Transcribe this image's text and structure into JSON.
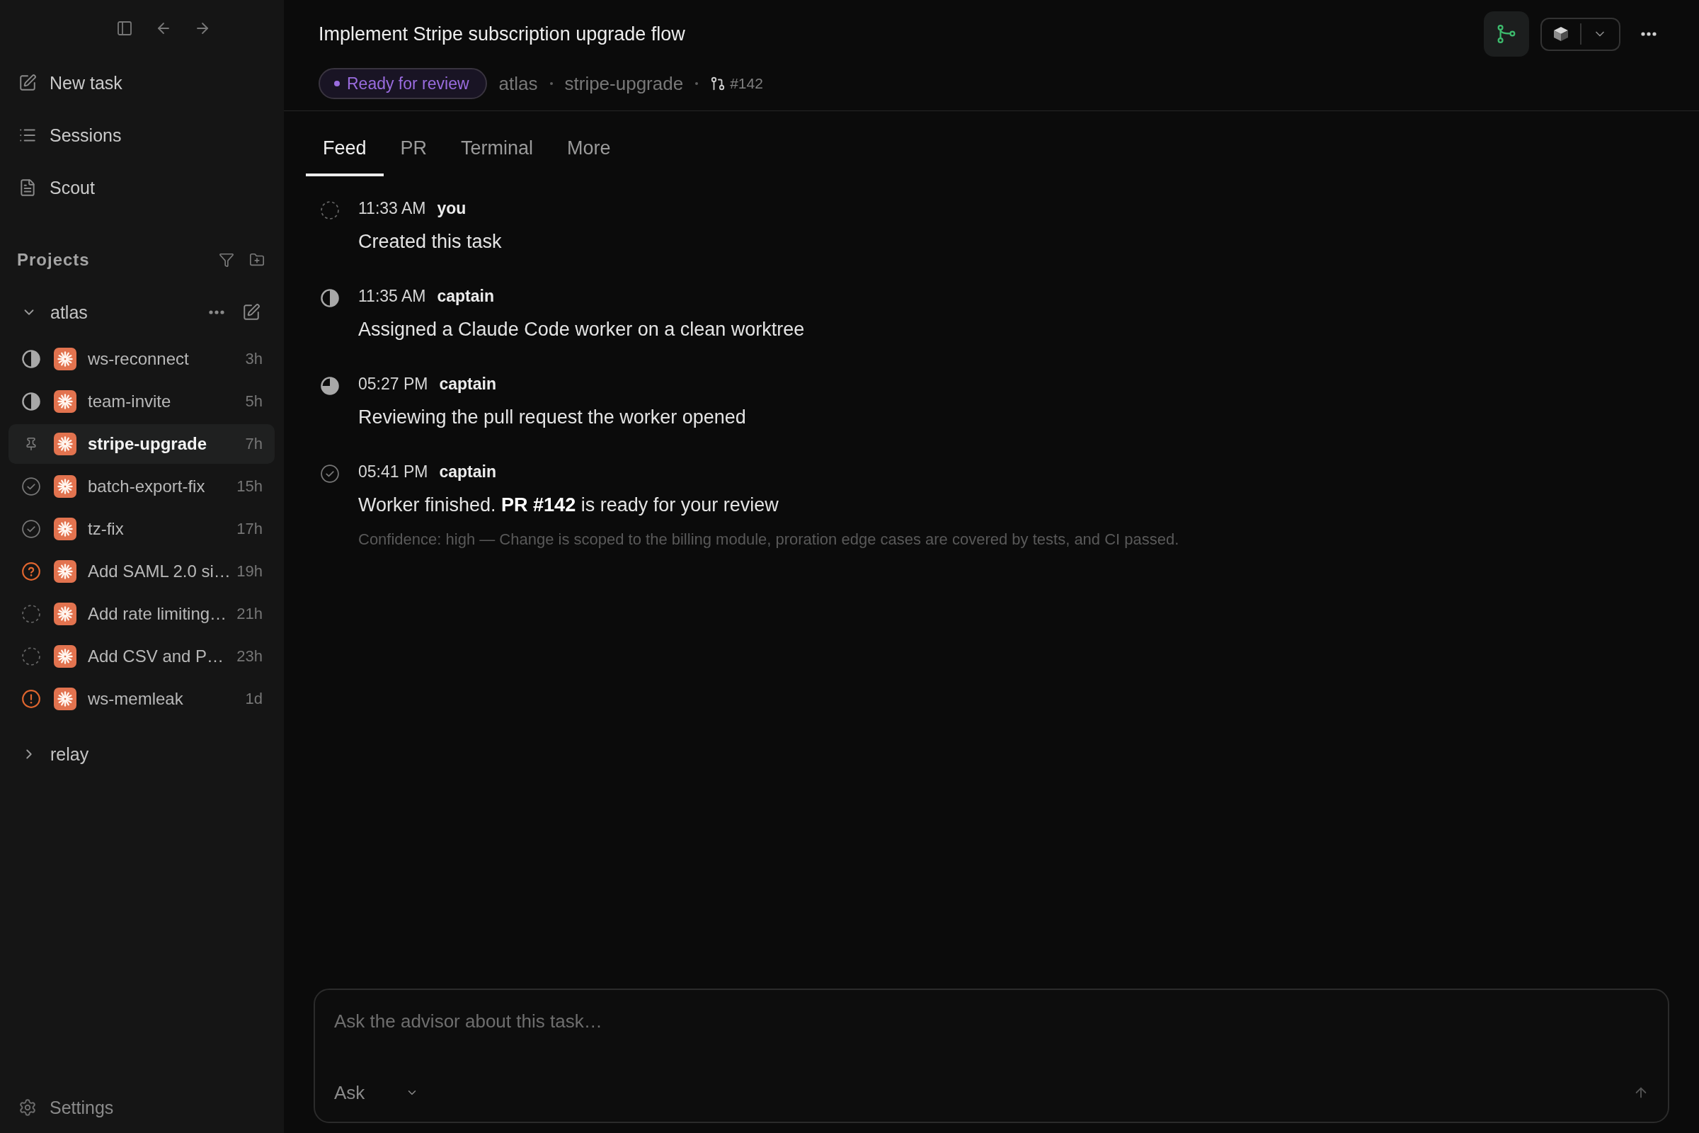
{
  "sidebar": {
    "nav": [
      {
        "kind": "new_task",
        "label": "New task"
      },
      {
        "kind": "sessions",
        "label": "Sessions"
      },
      {
        "kind": "scout",
        "label": "Scout"
      }
    ],
    "projects_heading": "Projects",
    "projects": [
      {
        "name": "atlas",
        "expanded": true,
        "tasks": [
          {
            "title": "ws-reconnect",
            "age": "3h",
            "kind": "in_progress",
            "selected": false
          },
          {
            "title": "team-invite",
            "age": "5h",
            "kind": "in_progress",
            "selected": false
          },
          {
            "title": "stripe-upgrade",
            "age": "7h",
            "kind": "pinned",
            "selected": true
          },
          {
            "title": "batch-export-fix",
            "age": "15h",
            "kind": "done",
            "selected": false
          },
          {
            "title": "tz-fix",
            "age": "17h",
            "kind": "done",
            "selected": false
          },
          {
            "title": "Add SAML 2.0 si…",
            "age": "19h",
            "kind": "needs_input",
            "selected": false
          },
          {
            "title": "Add rate limiting…",
            "age": "21h",
            "kind": "queued",
            "selected": false
          },
          {
            "title": "Add CSV and P…",
            "age": "23h",
            "kind": "queued",
            "selected": false
          },
          {
            "title": "ws-memleak",
            "age": "1d",
            "kind": "failed",
            "selected": false
          }
        ]
      },
      {
        "name": "relay",
        "expanded": false
      }
    ],
    "settings": {
      "label": "Settings"
    }
  },
  "task": {
    "title": "Implement Stripe subscription upgrade flow",
    "status_badge": "Ready for review",
    "project": "atlas",
    "branch": "stripe-upgrade",
    "pull_request": "#142"
  },
  "tabs": [
    {
      "label": "Feed",
      "selected": true
    },
    {
      "label": "PR",
      "selected": false
    },
    {
      "label": "Terminal",
      "selected": false
    },
    {
      "label": "More",
      "selected": false
    }
  ],
  "feed": [
    {
      "kind": "queued",
      "time": "11:33 AM",
      "author": "you",
      "message": "Created this task"
    },
    {
      "kind": "in_progress",
      "time": "11:35 AM",
      "author": "captain",
      "message": "Assigned a Claude Code worker on a clean worktree"
    },
    {
      "kind": "reviewing",
      "time": "05:27 PM",
      "author": "captain",
      "message": "Reviewing the pull request the worker opened"
    },
    {
      "kind": "done",
      "time": "05:41 PM",
      "author": "captain",
      "message": "Worker finished. **PR #142** is ready for your review",
      "note": "Confidence: high — Change is scoped to the billing module, proration edge cases are covered by tests, and CI passed."
    }
  ],
  "composer": {
    "placeholder": "Ask the advisor about this task…",
    "mode": "Ask"
  }
}
